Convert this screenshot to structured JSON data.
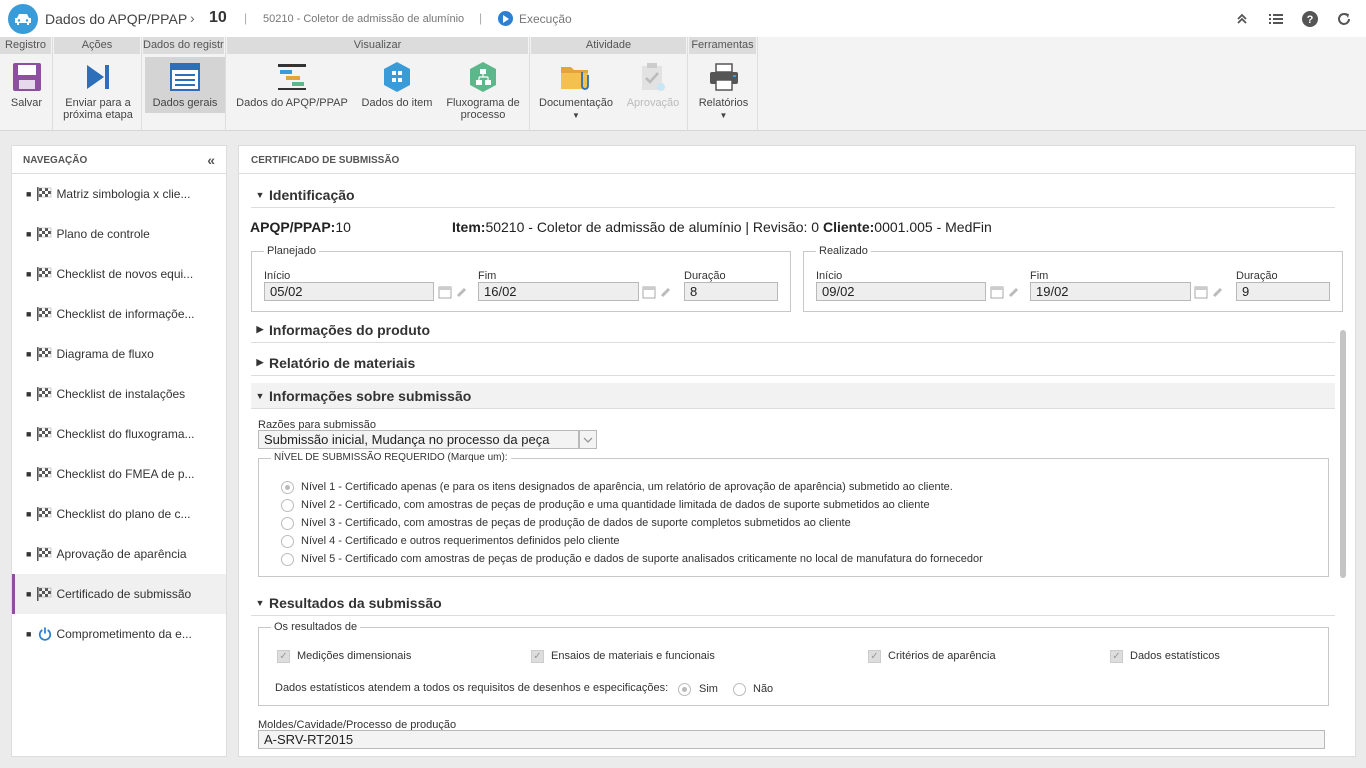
{
  "topbar": {
    "title": "Dados do APQP/PPAP",
    "number": "10",
    "item": "50210 - Coletor de admissão de alumínio",
    "status": "Execução"
  },
  "ribbon": {
    "groups": [
      {
        "label": "Registro"
      },
      {
        "label": "Ações"
      },
      {
        "label": "Dados do registro"
      },
      {
        "label": "Visualizar"
      },
      {
        "label": "Atividade"
      },
      {
        "label": "Ferramentas"
      }
    ],
    "buttons": {
      "save": "Salvar",
      "send_line1": "Enviar para a",
      "send_line2": "próxima etapa",
      "general": "Dados gerais",
      "apqp": "Dados do APQP/PPAP",
      "item": "Dados do item",
      "flow_line1": "Fluxograma de",
      "flow_line2": "processo",
      "docs": "Documentação",
      "approval": "Aprovação",
      "reports": "Relatórios"
    },
    "colors": {
      "save": "#8d4fa0",
      "send": "#2d6fb8",
      "item": "#3a9bd9",
      "flow": "#5cb88a",
      "docs": "#e7a33b"
    }
  },
  "nav": {
    "title": "NAVEGAÇÃO",
    "collapse_icon": "«",
    "items": [
      {
        "label": "Matriz simbologia x clie..."
      },
      {
        "label": "Plano de controle"
      },
      {
        "label": "Checklist de novos equi..."
      },
      {
        "label": "Checklist de informaçõe..."
      },
      {
        "label": "Diagrama de fluxo"
      },
      {
        "label": "Checklist de instalações"
      },
      {
        "label": "Checklist do fluxograma..."
      },
      {
        "label": "Checklist do FMEA de p..."
      },
      {
        "label": "Checklist do plano de c..."
      },
      {
        "label": "Aprovação de aparência"
      },
      {
        "label": "Certificado de submissão"
      },
      {
        "label": "Comprometimento da e..."
      }
    ],
    "selected_index": 10
  },
  "main": {
    "title": "CERTIFICADO DE SUBMISSÃO",
    "identificacao": {
      "heading": "Identificação",
      "apqp_label": "APQP/PPAP:",
      "apqp_value": "10",
      "item_label": "Item:",
      "item_value": "50210 - Coletor de admissão de alumínio | Revisão: 0",
      "cliente_label": "Cliente:",
      "cliente_value": "0001.005 - MedFin",
      "planejado": {
        "legend": "Planejado",
        "inicio_label": "Início",
        "inicio": "05/02",
        "fim_label": "Fim",
        "fim": "16/02",
        "duracao_label": "Duração",
        "duracao": "8"
      },
      "realizado": {
        "legend": "Realizado",
        "inicio_label": "Início",
        "inicio": "09/02",
        "fim_label": "Fim",
        "fim": "19/02",
        "duracao_label": "Duração",
        "duracao": "9"
      }
    },
    "produto": {
      "heading": "Informações do produto"
    },
    "materiais": {
      "heading": "Relatório de materiais"
    },
    "submissao": {
      "heading": "Informações sobre submissão",
      "razoes_label": "Razões para submissão",
      "razoes_value": "Submissão inicial, Mudança no processo da peça",
      "nivel_legend": "NÍVEL DE SUBMISSÃO REQUERIDO (Marque um):",
      "niveis": [
        "Nível 1 - Certificado apenas (e para os itens designados de aparência, um relatório de aprovação de aparência) submetido ao cliente.",
        "Nível 2 - Certificado, com amostras de peças de produção e uma quantidade limitada de dados de suporte submetidos ao cliente",
        "Nível 3 - Certificado, com amostras de peças de produção de dados de suporte completos submetidos ao cliente",
        "Nível 4 - Certificado e outros requerimentos definidos pelo cliente",
        "Nível 5 - Certificado com amostras de peças de produção e dados de suporte analisados criticamente no local de manufatura do fornecedor"
      ],
      "nivel_selected": 0
    },
    "resultados": {
      "heading": "Resultados da submissão",
      "legend": "Os resultados de",
      "checks": [
        "Medições dimensionais",
        "Ensaios de materiais e funcionais",
        "Critérios de aparência",
        "Dados estatísticos"
      ],
      "question": "Dados estatísticos atendem a todos os requisitos de desenhos e especificações:",
      "sim": "Sim",
      "nao": "Não",
      "moldes_label": "Moldes/Cavidade/Processo de produção",
      "moldes_value": "A-SRV-RT2015"
    }
  }
}
